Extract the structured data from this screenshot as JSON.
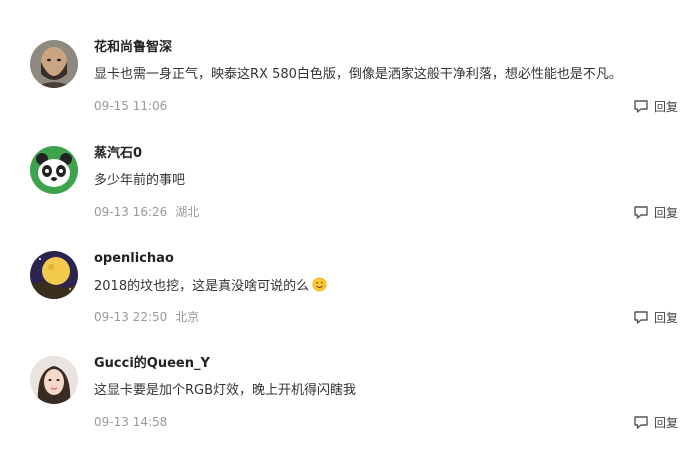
{
  "comments": [
    {
      "username": "花和尚鲁智深",
      "content": "显卡也需一身正气，映泰这RX 580白色版，倒像是洒家这般干净利落，想必性能也是不凡。",
      "time": "09-15 11:06",
      "location": "",
      "reply_label": "回复",
      "avatar_icon": "bearded-man-avatar"
    },
    {
      "username": "蒸汽石0",
      "content": "多少年前的事吧",
      "time": "09-13 16:26",
      "location": "湖北",
      "reply_label": "回复",
      "avatar_icon": "panda-avatar"
    },
    {
      "username": "openlichao",
      "content": "2018的坟也挖，这是真没啥可说的么",
      "time": "09-13 22:50",
      "location": "北京",
      "reply_label": "回复",
      "avatar_icon": "moon-night-avatar",
      "emoji": "smiling-face-emoji"
    },
    {
      "username": "Gucci的Queen_Y",
      "content": "这显卡要是加个RGB灯效，晚上开机得闪瞎我",
      "time": "09-13 14:58",
      "location": "",
      "reply_label": "回复",
      "avatar_icon": "woman-portrait-avatar"
    }
  ],
  "colors": {
    "username": "#222222",
    "content": "#333333",
    "meta": "#999999"
  }
}
